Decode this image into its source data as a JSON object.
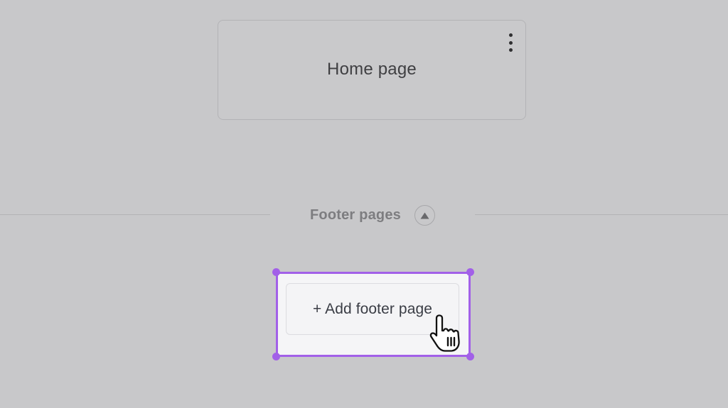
{
  "home_card": {
    "title": "Home page",
    "menu_icon": "kebab-menu-icon"
  },
  "footer_section": {
    "label": "Footer pages",
    "toggle_icon": "caret-up-icon"
  },
  "add_footer": {
    "label": "+ Add footer page"
  },
  "colors": {
    "background": "#c8c8ca",
    "selection_accent": "#a260e8",
    "button_background": "#f4f4f6"
  },
  "cursor_icon": "hand-pointer-cursor-icon"
}
